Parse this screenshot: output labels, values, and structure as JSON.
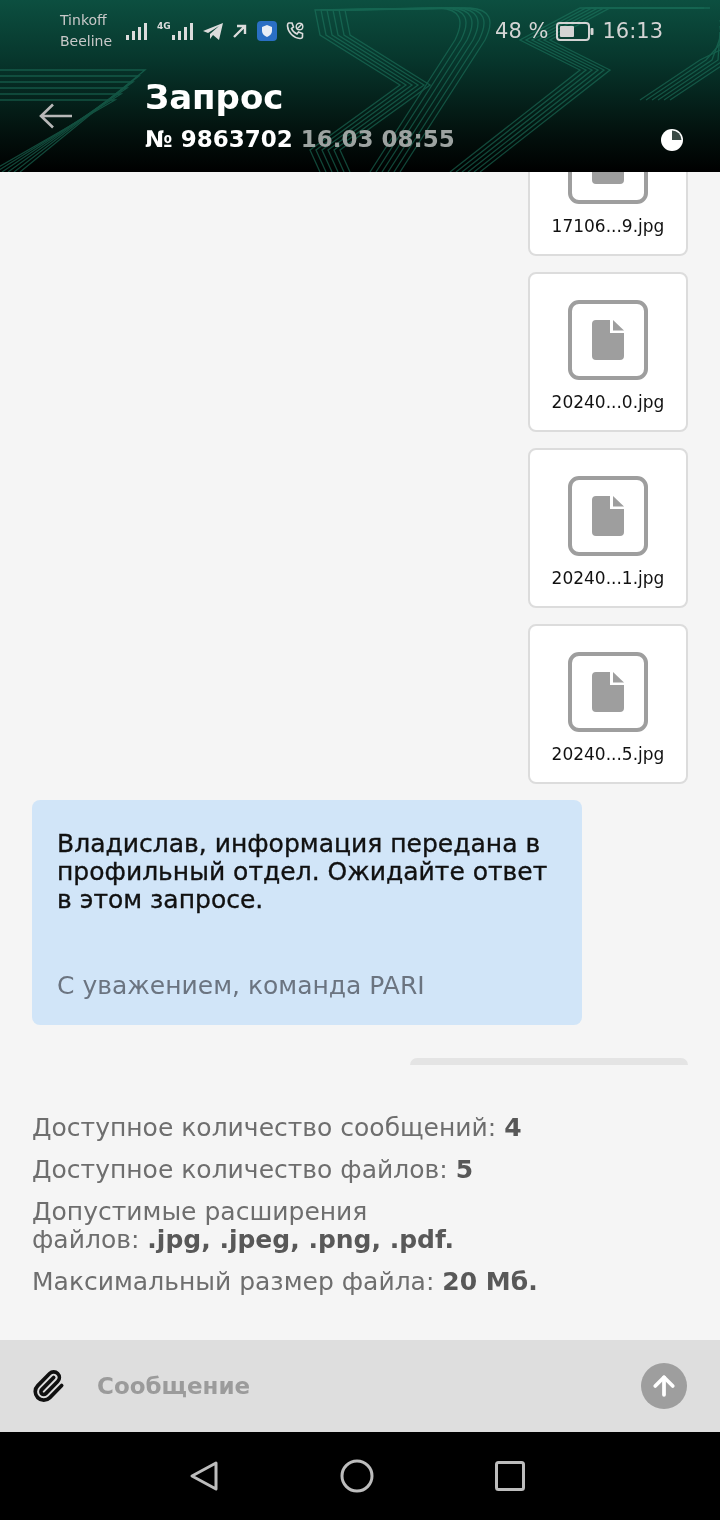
{
  "status_bar": {
    "carriers": [
      "Tinkoff",
      "Beeline"
    ],
    "network": "4G",
    "battery": "48 %",
    "time": "16:13"
  },
  "header": {
    "title": "Запрос",
    "number": "№ 9863702",
    "date": "16.03 08:55"
  },
  "messages": [
    {
      "kind": "files",
      "files": [
        {
          "name": "17106...9.jpg"
        },
        {
          "name": "20240...0.jpg"
        },
        {
          "name": "20240...1.jpg"
        },
        {
          "name": "20240...5.jpg"
        }
      ]
    },
    {
      "kind": "support",
      "text": "Владислав, информация передана в профильный отдел. Ожидайте ответ в этом запросе.",
      "signature": "С уважением, команда PARI"
    },
    {
      "kind": "outgoing"
    }
  ],
  "limits": [
    "Доступное количество сообщений: **4**",
    "Доступное количество файлов: **5**",
    "Допустимые расширения\nфайлов: **.jpg, .jpeg, .png, .pdf.**",
    "Максимальный размер файла: **20 Мб.**"
  ],
  "composer": {
    "placeholder": "Сообщение"
  }
}
